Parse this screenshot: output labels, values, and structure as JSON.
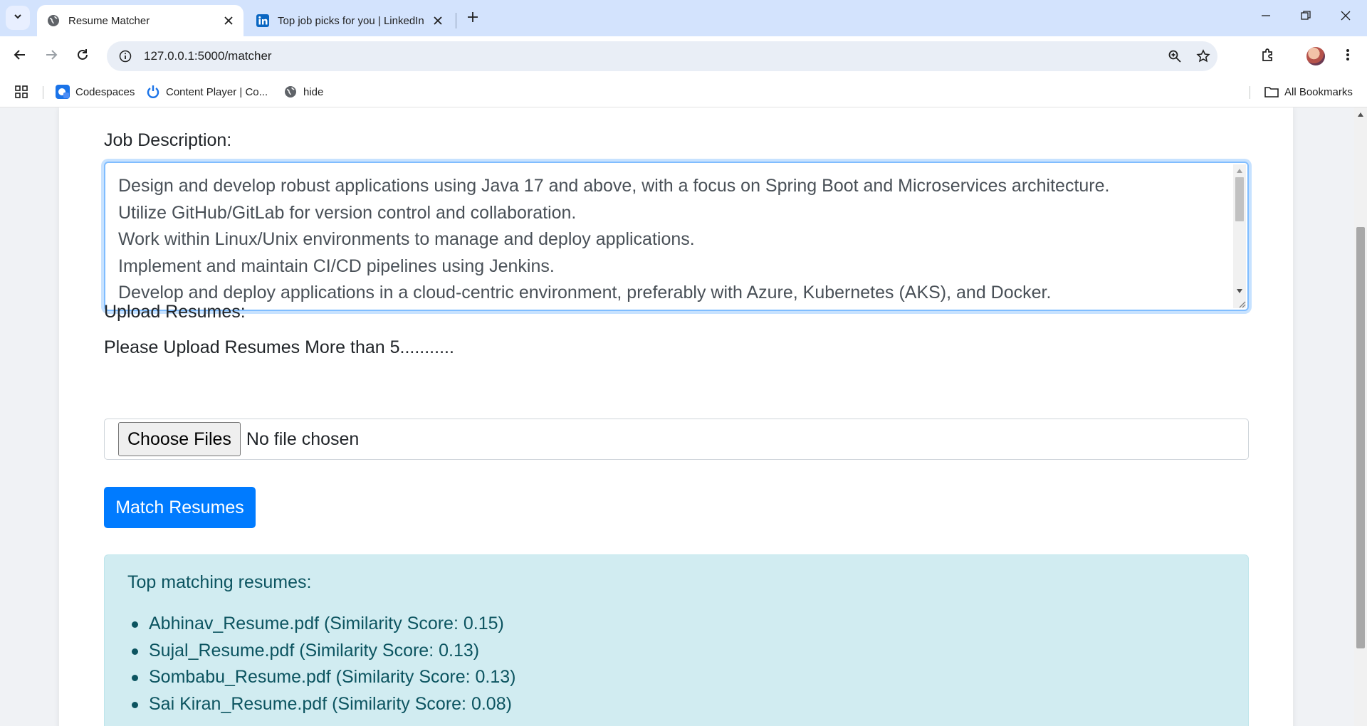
{
  "browser": {
    "tabs": [
      {
        "title": "Resume Matcher",
        "active": true,
        "favicon": "globe-icon"
      },
      {
        "title": "Top job picks for you | LinkedIn",
        "active": false,
        "favicon": "linkedin-icon"
      }
    ],
    "url": "127.0.0.1:5000/matcher",
    "bookmarks": [
      {
        "label": "Codespaces",
        "icon": "codespaces-icon"
      },
      {
        "label": "Content Player | Co...",
        "icon": "power-icon"
      },
      {
        "label": "hide",
        "icon": "globe-icon"
      }
    ],
    "all_bookmarks_label": "All Bookmarks"
  },
  "form": {
    "job_description_label": "Job Description:",
    "job_description_lines": [
      "Design and develop robust applications using Java 17 and above, with a focus on Spring Boot and Microservices architecture.",
      "Utilize GitHub/GitLab for version control and collaboration.",
      "Work within Linux/Unix environments to manage and deploy applications.",
      "Implement and maintain CI/CD pipelines using Jenkins.",
      "Develop and deploy applications in a cloud-centric environment, preferably with Azure, Kubernetes (AKS), and Docker."
    ],
    "upload_label": "Upload Resumes:",
    "upload_hint": "Please Upload Resumes More than 5...........",
    "choose_files_label": "Choose Files",
    "no_file_text": "No file chosen",
    "match_button_label": "Match Resumes"
  },
  "results": {
    "heading": "Top matching resumes:",
    "items": [
      "Abhinav_Resume.pdf (Similarity Score: 0.15)",
      "Sujal_Resume.pdf (Similarity Score: 0.13)",
      "Sombabu_Resume.pdf (Similarity Score: 0.13)",
      "Sai Kiran_Resume.pdf (Similarity Score: 0.08)"
    ]
  },
  "colors": {
    "primary": "#007bff",
    "alert_bg": "#d1ecf1",
    "alert_text": "#0c5460",
    "tabstrip": "#d3e3fd"
  }
}
